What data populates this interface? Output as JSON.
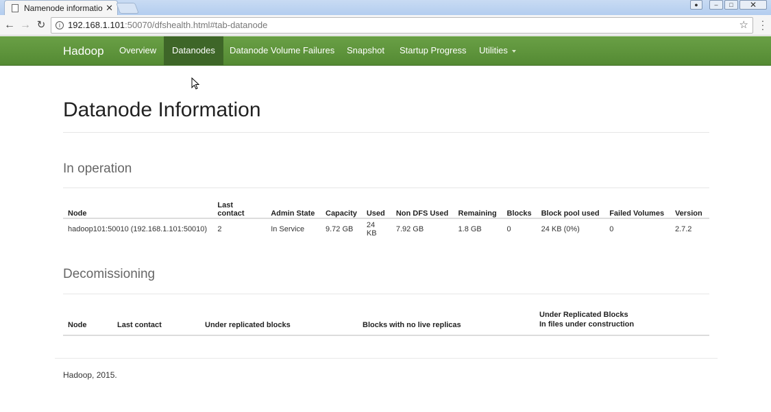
{
  "browser": {
    "tab_title": "Namenode informatio",
    "url_host": "192.168.1.101",
    "url_path": ":50070/dfshealth.html#tab-datanode"
  },
  "navbar": {
    "brand": "Hadoop",
    "items": [
      {
        "label": "Overview"
      },
      {
        "label": "Datanodes",
        "active": true
      },
      {
        "label": "Datanode Volume Failures"
      },
      {
        "label": "Snapshot"
      },
      {
        "label": "Startup Progress"
      },
      {
        "label": "Utilities"
      }
    ],
    "color": "#5f9640",
    "active_color": "#3e6628"
  },
  "page": {
    "title": "Datanode Information"
  },
  "in_operation": {
    "title": "In operation",
    "headers": [
      "Node",
      "Last contact",
      "Admin State",
      "Capacity",
      "Used",
      "Non DFS Used",
      "Remaining",
      "Blocks",
      "Block pool used",
      "Failed Volumes",
      "Version"
    ],
    "rows": [
      [
        "hadoop101:50010 (192.168.1.101:50010)",
        "2",
        "In Service",
        "9.72 GB",
        "24 KB",
        "7.92 GB",
        "1.8 GB",
        "0",
        "24 KB (0%)",
        "0",
        "2.7.2"
      ]
    ]
  },
  "decomissioning": {
    "title": "Decomissioning",
    "headers": [
      "Node",
      "Last contact",
      "Under replicated blocks",
      "Blocks with no live replicas",
      "Under Replicated Blocks",
      "In files under construction"
    ]
  },
  "footer": {
    "text": "Hadoop, 2015."
  }
}
